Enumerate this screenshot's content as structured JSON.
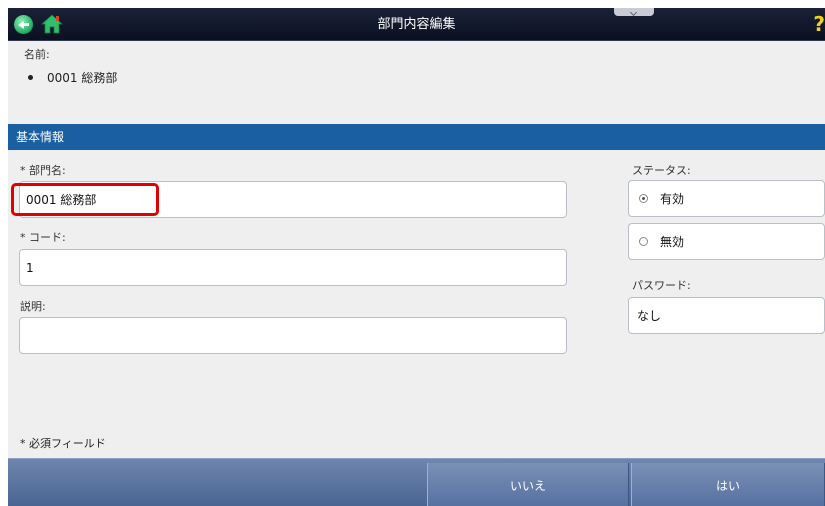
{
  "titlebar": {
    "title": "部門内容編集",
    "help_glyph": "?"
  },
  "name": {
    "label": "名前:",
    "value": "0001 総務部"
  },
  "section": {
    "title": "基本情報"
  },
  "form": {
    "department_name_label": "* 部門名:",
    "department_name_value": "0001 総務部",
    "code_label": "* コード:",
    "code_value": "1",
    "description_label": "説明:",
    "description_value": "",
    "status_label": "ステータス:",
    "status_options": [
      {
        "label": "有効",
        "selected": true
      },
      {
        "label": "無効",
        "selected": false
      }
    ],
    "password_label": "パスワード:",
    "password_value": "なし"
  },
  "required_note": "* 必須フィールド",
  "footer": {
    "no_label": "いいえ",
    "yes_label": "はい"
  },
  "colors": {
    "section_header": "#1b5fa3",
    "highlight": "#e00000",
    "footer": "#5670a0"
  },
  "icons": [
    "back-arrow-icon",
    "home-icon",
    "help-icon",
    "radio-selected-icon",
    "radio-unselected-icon"
  ]
}
